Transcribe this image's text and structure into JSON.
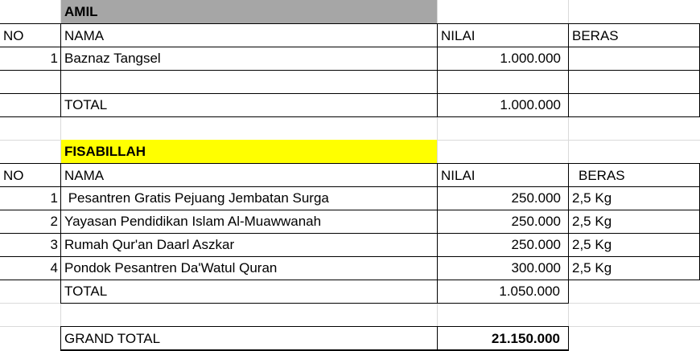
{
  "amil": {
    "title": "AMIL",
    "headers": {
      "no": "NO",
      "nama": "NAMA",
      "nilai": "NILAI",
      "beras": "BERAS"
    },
    "rows": [
      {
        "no": "1",
        "nama": "Baznaz Tangsel",
        "nilai": "1.000.000",
        "beras": ""
      }
    ],
    "total_label": "TOTAL",
    "total_value": "1.000.000"
  },
  "fisabillah": {
    "title": "FISABILLAH",
    "headers": {
      "no": "NO",
      "nama": "NAMA",
      "nilai": "NILAI",
      "beras": "BERAS"
    },
    "rows": [
      {
        "no": "1",
        "nama": " Pesantren Gratis Pejuang Jembatan Surga",
        "nilai": "250.000",
        "beras": "2,5 Kg"
      },
      {
        "no": "2",
        "nama": "Yayasan Pendidikan Islam Al-Muawwanah",
        "nilai": "250.000",
        "beras": "2,5 Kg"
      },
      {
        "no": "3",
        "nama": "Rumah Qur'an Daarl Aszkar",
        "nilai": "250.000",
        "beras": "2,5 Kg"
      },
      {
        "no": "4",
        "nama": "Pondok Pesantren Da'Watul Quran",
        "nilai": "300.000",
        "beras": "2,5 Kg"
      }
    ],
    "total_label": "TOTAL",
    "total_value": "1.050.000"
  },
  "grand_total": {
    "label": "GRAND TOTAL",
    "value": "21.150.000"
  },
  "colors": {
    "amil_header_fill": "#a6a6a6",
    "fisabillah_header_fill": "#ffff00",
    "gridline": "#dadada",
    "border": "#000000"
  }
}
